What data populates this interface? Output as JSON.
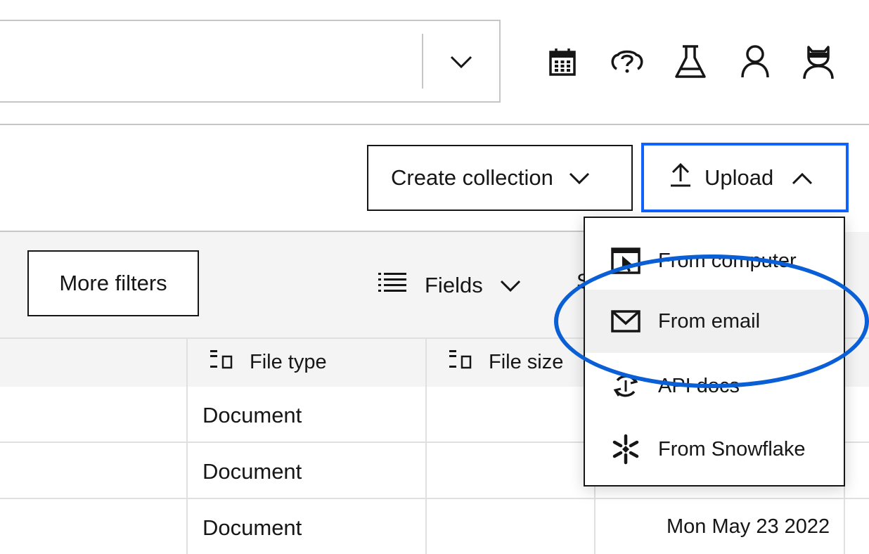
{
  "header": {
    "search": {
      "value": "",
      "placeholder": ""
    },
    "icons": [
      "calendar-icon",
      "help-icon",
      "flask-icon",
      "user-icon",
      "admin-user-icon"
    ]
  },
  "actions": {
    "create_collection_label": "Create collection",
    "upload_label": "Upload"
  },
  "upload_menu": {
    "items": [
      {
        "label": "From computer",
        "icon": "upload-from-computer-icon"
      },
      {
        "label": "From email",
        "icon": "email-icon",
        "highlighted": true
      },
      {
        "label": "API docs",
        "icon": "api-docs-icon"
      },
      {
        "label": "From Snowflake",
        "icon": "snowflake-icon"
      }
    ]
  },
  "toolbar": {
    "more_filters_label": "More filters",
    "fields_label": "Fields",
    "sort_fragment": "S"
  },
  "table": {
    "columns": [
      "File type",
      "File size"
    ],
    "rows": [
      {
        "file_type": "Document",
        "file_size": "",
        "date": ""
      },
      {
        "file_type": "Document",
        "file_size": "",
        "date": ""
      },
      {
        "file_type": "Document",
        "file_size": "",
        "date": "Mon May 23 2022"
      }
    ]
  },
  "colors": {
    "accent": "#0f62fe",
    "highlight": "#0a5fd6",
    "border": "#161616",
    "subtle_border": "#c6c6c6",
    "toolbar_bg": "#f4f4f4"
  }
}
